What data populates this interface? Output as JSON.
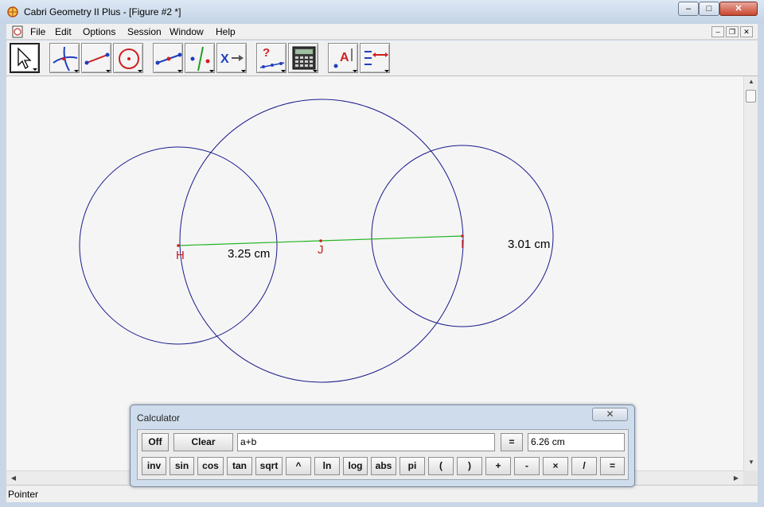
{
  "window": {
    "title": "Cabri Geometry II Plus - [Figure #2 *]",
    "minimize": "–",
    "maximize": "□",
    "close": "✕"
  },
  "menu": {
    "items": [
      "File",
      "Edit",
      "Options",
      "Session",
      "Window",
      "Help"
    ],
    "mdi_min": "–",
    "mdi_restore": "❐",
    "mdi_close": "✕"
  },
  "toolbar": {
    "tools": [
      "pointer-tool",
      "points-tool",
      "lines-tool",
      "curves-tool",
      "construct-tool",
      "transform-tool",
      "macro-tool",
      "properties-tool",
      "measure-tool",
      "display-tool",
      "attributes-tool"
    ]
  },
  "figure": {
    "labels": {
      "H": "H",
      "J": "J",
      "I": "I",
      "measure1": "3.25 cm",
      "measure2": "3.01 cm"
    },
    "colors": {
      "circle": "#1a1a8c",
      "segment": "#22b422",
      "label": "#c81e1e"
    }
  },
  "status": {
    "text": "Pointer"
  },
  "calculator": {
    "title": "Calculator",
    "close": "✕",
    "off": "Off",
    "clear": "Clear",
    "expression": "a+b",
    "equals": "=",
    "result": "6.26 cm",
    "keys": [
      "inv",
      "sin",
      "cos",
      "tan",
      "sqrt",
      "^",
      "ln",
      "log",
      "abs",
      "pi",
      "(",
      ")",
      "+",
      "-",
      "×",
      "/",
      "="
    ]
  }
}
